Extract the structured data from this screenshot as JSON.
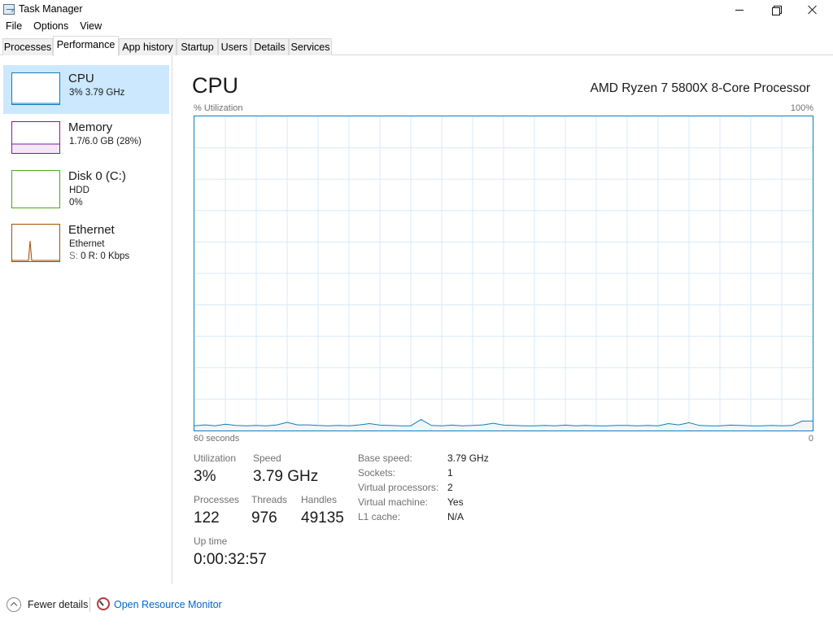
{
  "window": {
    "title": "Task Manager",
    "minimize_icon": "minimize-icon",
    "maximize_icon": "restore-icon",
    "close_icon": "close-icon"
  },
  "menu": [
    "File",
    "Options",
    "View"
  ],
  "tabs": [
    {
      "label": "Processes",
      "active": false
    },
    {
      "label": "Performance",
      "active": true
    },
    {
      "label": "App history",
      "active": false
    },
    {
      "label": "Startup",
      "active": false
    },
    {
      "label": "Users",
      "active": false
    },
    {
      "label": "Details",
      "active": false
    },
    {
      "label": "Services",
      "active": false
    }
  ],
  "sidebar": {
    "items": [
      {
        "name": "CPU",
        "line1": "3% 3.79 GHz",
        "line2": "",
        "color": "#117dbb",
        "selected": true
      },
      {
        "name": "Memory",
        "line1": "1.7/6.0 GB (28%)",
        "line2": "",
        "color": "#8b12ae",
        "selected": false
      },
      {
        "name": "Disk 0 (C:)",
        "line1": "HDD",
        "line2": "0%",
        "color": "#4da60c",
        "selected": false
      },
      {
        "name": "Ethernet",
        "line1": "Ethernet",
        "line2_s": "S:",
        "line2_rest": " 0  R: 0 Kbps",
        "color": "#a74f01",
        "selected": false
      }
    ]
  },
  "main": {
    "title": "CPU",
    "processor": "AMD Ryzen 7 5800X 8-Core Processor",
    "util_label": "% Utilization",
    "max_label": "100%",
    "time_left_label": "60 seconds",
    "time_right_label": "0",
    "graph_color": "#117dbb",
    "grid_color": "#d9eaf7"
  },
  "chart_data": {
    "type": "area",
    "ylabel": "% Utilization",
    "ylim": [
      0,
      100
    ],
    "xlim": [
      60,
      0
    ],
    "xlabel_left": "60 seconds",
    "xlabel_right": "0",
    "grid": true,
    "series": [
      {
        "x": [
          60,
          59,
          58,
          57,
          56,
          55,
          54,
          53,
          52,
          51,
          50,
          49,
          48,
          47,
          46,
          45,
          44,
          43,
          42,
          41,
          40,
          39,
          38,
          37,
          36,
          35,
          34,
          33,
          32,
          31,
          30,
          29,
          28,
          27,
          26,
          25,
          24,
          23,
          22,
          21,
          20,
          19,
          18,
          17,
          16,
          15,
          14,
          13,
          12,
          11,
          10,
          9,
          8,
          7,
          6,
          5,
          4,
          3,
          2,
          1,
          0
        ],
        "values": [
          1.5,
          1.8,
          1.5,
          2.0,
          1.6,
          1.5,
          1.6,
          1.5,
          1.8,
          2.6,
          1.8,
          1.8,
          1.6,
          1.5,
          1.6,
          1.5,
          1.8,
          2.2,
          1.7,
          1.6,
          1.5,
          1.5,
          3.5,
          1.6,
          1.5,
          1.7,
          1.5,
          1.6,
          1.8,
          2.3,
          1.7,
          1.6,
          1.5,
          1.5,
          1.6,
          1.5,
          1.7,
          1.5,
          1.6,
          1.5,
          1.5,
          1.6,
          1.6,
          1.5,
          1.6,
          1.5,
          2.2,
          1.8,
          2.5,
          1.6,
          1.5,
          1.5,
          1.7,
          1.6,
          1.5,
          1.5,
          1.6,
          1.5,
          1.6,
          3.0,
          3.0
        ]
      }
    ]
  },
  "stats": {
    "utilization_label": "Utilization",
    "utilization_value": "3%",
    "speed_label": "Speed",
    "speed_value": "3.79 GHz",
    "processes_label": "Processes",
    "processes_value": "122",
    "threads_label": "Threads",
    "threads_value": "976",
    "handles_label": "Handles",
    "handles_value": "49135",
    "uptime_label": "Up time",
    "uptime_value": "0:00:32:57"
  },
  "specs": [
    {
      "label": "Base speed:",
      "value": "3.79 GHz"
    },
    {
      "label": "Sockets:",
      "value": "1"
    },
    {
      "label": "Virtual processors:",
      "value": "2"
    },
    {
      "label": "Virtual machine:",
      "value": "Yes"
    },
    {
      "label": "L1 cache:",
      "value": "N/A"
    }
  ],
  "footer": {
    "fewer_details": "Fewer details",
    "resource_monitor": "Open Resource Monitor",
    "fewer_icon": "chevron-up-circle-icon",
    "monitor_icon": "resource-monitor-icon"
  }
}
